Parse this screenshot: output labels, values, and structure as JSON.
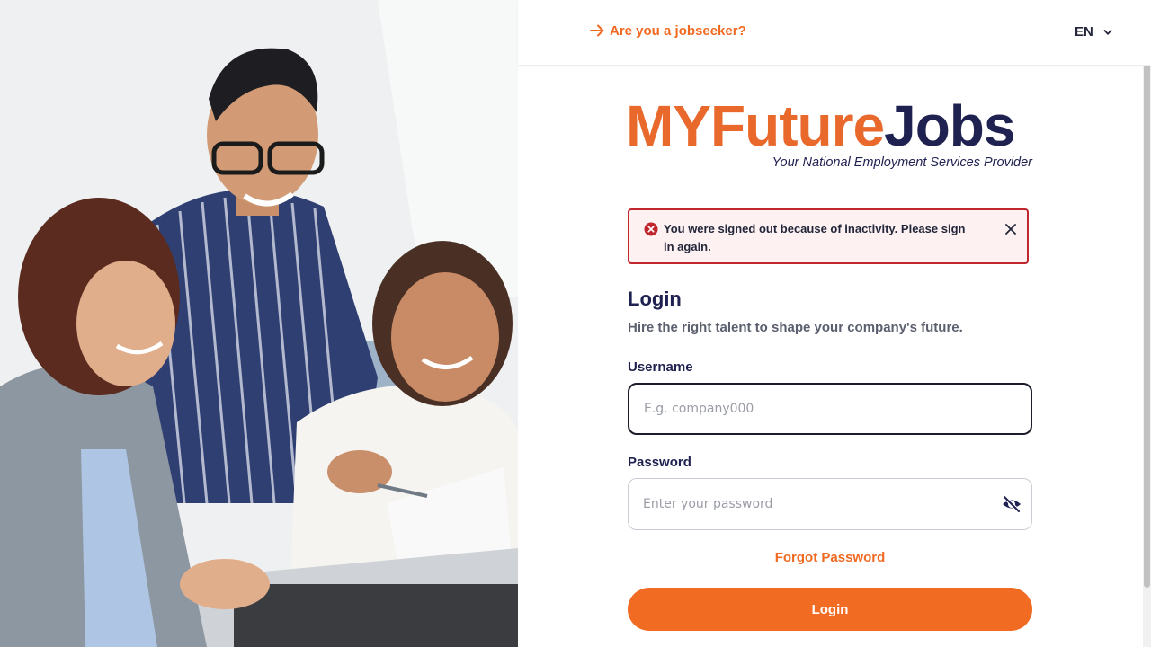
{
  "header": {
    "jobseeker_link": "Are you a jobseeker?",
    "language": "EN"
  },
  "brand": {
    "logo_part1": "MYFuture",
    "logo_part2": "Jobs",
    "tagline": "Your National Employment Services Provider",
    "accent_color": "#f06a22",
    "navy_color": "#1f2150"
  },
  "alert": {
    "message": "You were signed out because of inactivity. Please sign in again.",
    "icon": "error-circle-icon",
    "border_color": "#c0262d"
  },
  "form": {
    "title": "Login",
    "subtitle": "Hire the right talent to shape your company's future.",
    "username_label": "Username",
    "username_placeholder": "E.g. company000",
    "username_value": "",
    "password_label": "Password",
    "password_placeholder": "Enter your password",
    "password_value": "",
    "forgot_password": "Forgot Password",
    "login_button": "Login"
  },
  "icons": {
    "jobseeker": "arrow-right-icon",
    "language": "chevron-down-icon",
    "close": "close-icon",
    "password_toggle": "eye-slash-icon"
  }
}
